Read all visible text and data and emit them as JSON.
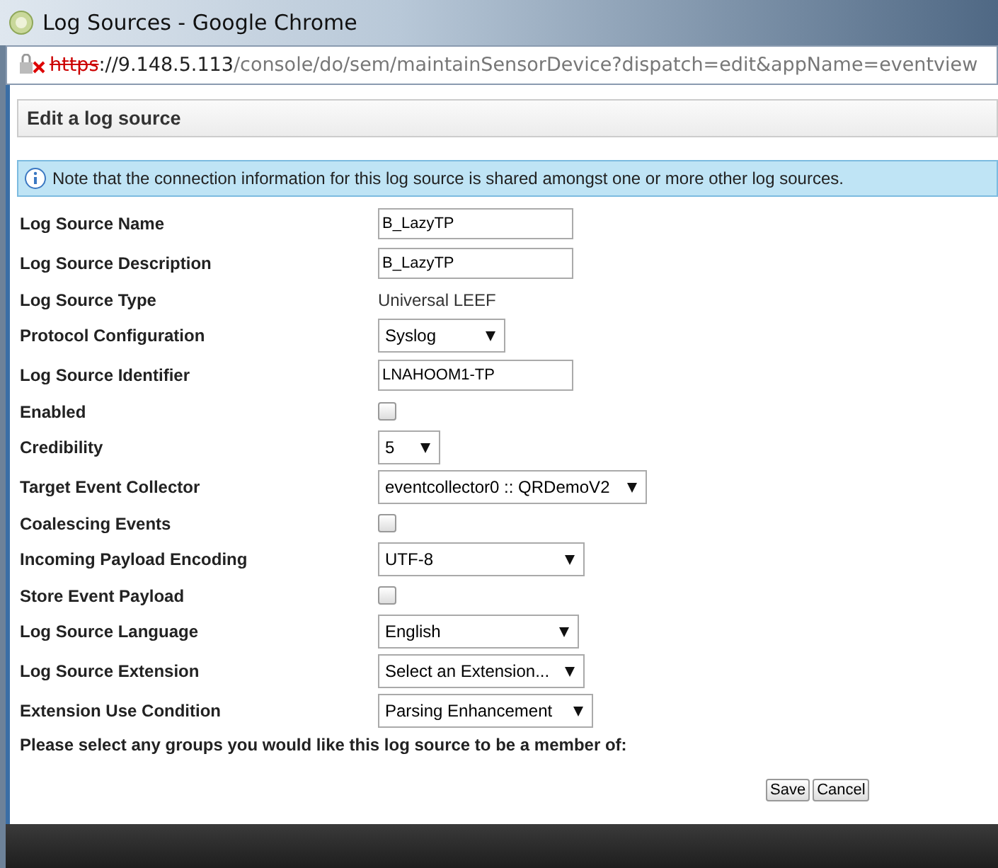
{
  "window": {
    "title": "Log Sources - Google Chrome"
  },
  "address_bar": {
    "scheme": "https",
    "host": "://9.148.5.113",
    "path": "/console/do/sem/maintainSensorDevice?dispatch=edit&appName=eventview"
  },
  "panel": {
    "title": "Edit a log source"
  },
  "info": {
    "message": "Note that the connection information for this log source is shared amongst one or more other log sources."
  },
  "fields": [
    {
      "kind": "text",
      "label": "Log Source Name",
      "value": "B_LazyTP"
    },
    {
      "kind": "text",
      "label": "Log Source Description",
      "value": "B_LazyTP"
    },
    {
      "kind": "static",
      "label": "Log Source Type",
      "value": "Universal LEEF"
    },
    {
      "kind": "select",
      "label": "Protocol Configuration",
      "value": "Syslog"
    },
    {
      "kind": "text",
      "label": "Log Source Identifier",
      "value": "LNAHOOM1-TP"
    },
    {
      "kind": "checkbox",
      "label": "Enabled",
      "checked": false
    },
    {
      "kind": "select",
      "label": "Credibility",
      "value": "5"
    },
    {
      "kind": "select",
      "label": "Target Event Collector",
      "value": "eventcollector0 :: QRDemoV2"
    },
    {
      "kind": "checkbox",
      "label": "Coalescing Events",
      "checked": false
    },
    {
      "kind": "select",
      "label": "Incoming Payload Encoding",
      "value": "UTF-8"
    },
    {
      "kind": "checkbox",
      "label": "Store Event Payload",
      "checked": false
    },
    {
      "kind": "select",
      "label": "Log Source Language",
      "value": "English"
    },
    {
      "kind": "select",
      "label": "Log Source Extension",
      "value": "Select an Extension..."
    },
    {
      "kind": "select",
      "label": "Extension Use Condition",
      "value": "Parsing Enhancement"
    }
  ],
  "groups_prompt": "Please select any groups you would like this log source to be a member of:",
  "buttons": [
    "Save",
    "Cancel"
  ]
}
